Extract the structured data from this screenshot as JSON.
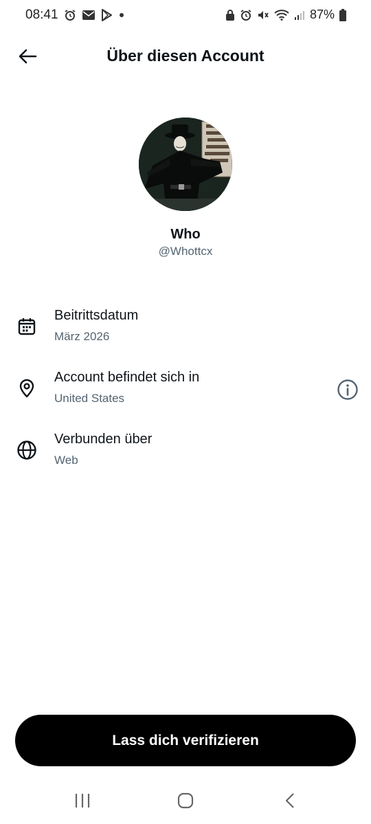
{
  "status_bar": {
    "time": "08:41",
    "battery_percent": "87%",
    "left_icons": [
      "alarm-icon",
      "mail-icon",
      "play-store-icon",
      "dot-icon"
    ],
    "right_icons": [
      "lock-icon",
      "alarm-icon",
      "mute-icon",
      "wifi-icon",
      "signal-icon",
      "battery-icon"
    ]
  },
  "header": {
    "title": "Über diesen Account",
    "back_icon": "arrow-left-icon"
  },
  "profile": {
    "display_name": "Who",
    "handle": "@Whottcx"
  },
  "info": [
    {
      "icon": "calendar-icon",
      "title": "Beitrittsdatum",
      "value": "März 2026"
    },
    {
      "icon": "location-pin-icon",
      "title": "Account befindet sich in",
      "value": "United States",
      "action_icon": "info-icon"
    },
    {
      "icon": "globe-icon",
      "title": "Verbunden über",
      "value": "Web"
    }
  ],
  "cta": {
    "label": "Lass dich verifizieren"
  },
  "nav_bar": {
    "buttons": [
      "recent-apps-icon",
      "home-icon",
      "back-icon"
    ]
  },
  "colors": {
    "text_primary": "#0f1419",
    "text_secondary": "#536471",
    "button_bg": "#000000",
    "button_text": "#ffffff"
  }
}
